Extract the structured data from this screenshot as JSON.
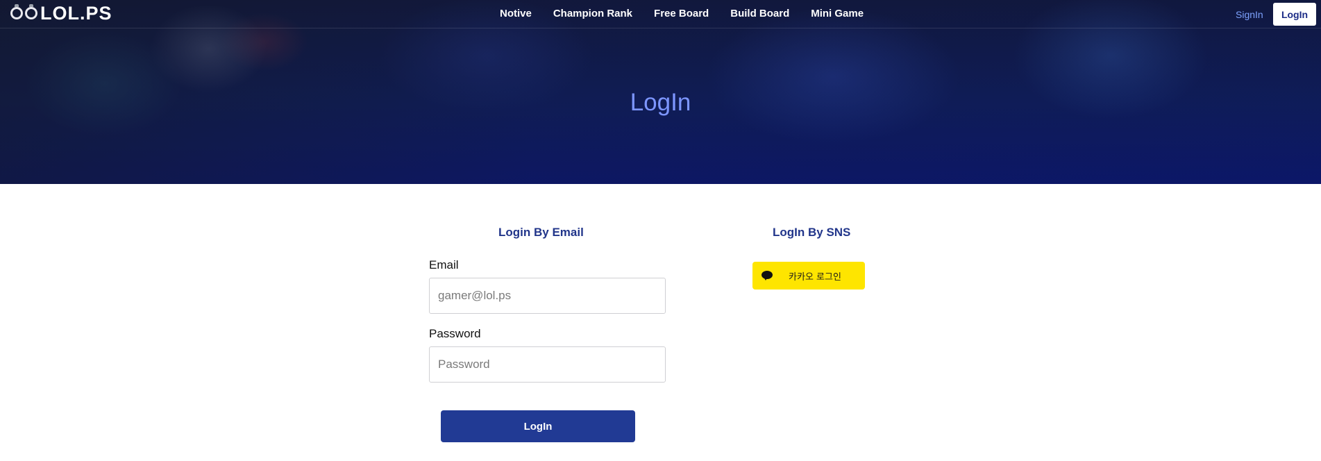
{
  "brand": {
    "name": "LOL.PS"
  },
  "nav": {
    "links": [
      "Notive",
      "Champion Rank",
      "Free Board",
      "Build Board",
      "Mini Game"
    ],
    "signin_label": "SignIn",
    "login_label": "LogIn"
  },
  "hero": {
    "title": "LogIn"
  },
  "email_login": {
    "heading": "Login By Email",
    "email_label": "Email",
    "email_placeholder": "gamer@lol.ps",
    "email_value": "",
    "password_label": "Password",
    "password_placeholder": "Password",
    "password_value": "",
    "submit_label": "LogIn"
  },
  "sns_login": {
    "heading": "LogIn By SNS",
    "kakao_label": "카카오 로그인",
    "kakao_icon": "speech-bubble-icon"
  },
  "colors": {
    "primary": "#213a94",
    "heading": "#21358a",
    "hero_title": "#7d96ff",
    "signin_link": "#7ea3ff",
    "kakao_yellow": "#fee500"
  }
}
